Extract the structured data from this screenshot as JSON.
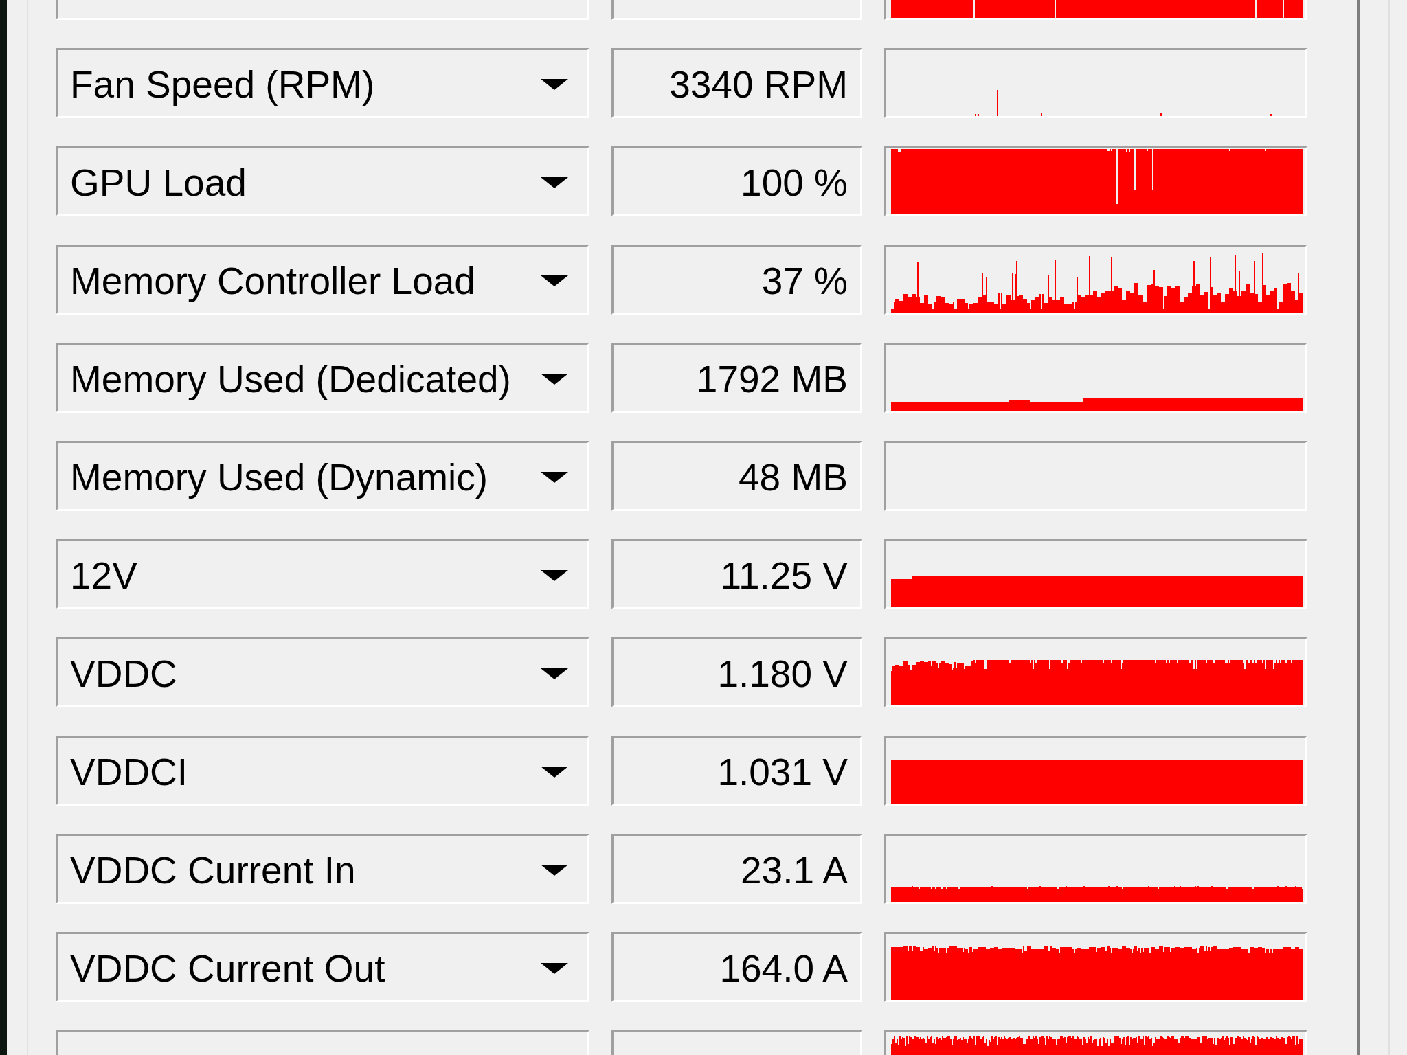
{
  "sensors": [
    {
      "name": "Fan Speed (RPM)",
      "value": "3340 RPM"
    },
    {
      "name": "GPU Load",
      "value": "100 %"
    },
    {
      "name": "Memory Controller Load",
      "value": "37 %"
    },
    {
      "name": "Memory Used (Dedicated)",
      "value": "1792 MB"
    },
    {
      "name": "Memory Used (Dynamic)",
      "value": "48 MB"
    },
    {
      "name": "12V",
      "value": "11.25 V"
    },
    {
      "name": "VDDC",
      "value": "1.180 V"
    },
    {
      "name": "VDDCI",
      "value": "1.031 V"
    },
    {
      "name": "VDDC Current In",
      "value": "23.1 A"
    },
    {
      "name": "VDDC Current Out",
      "value": "164.0 A"
    }
  ]
}
